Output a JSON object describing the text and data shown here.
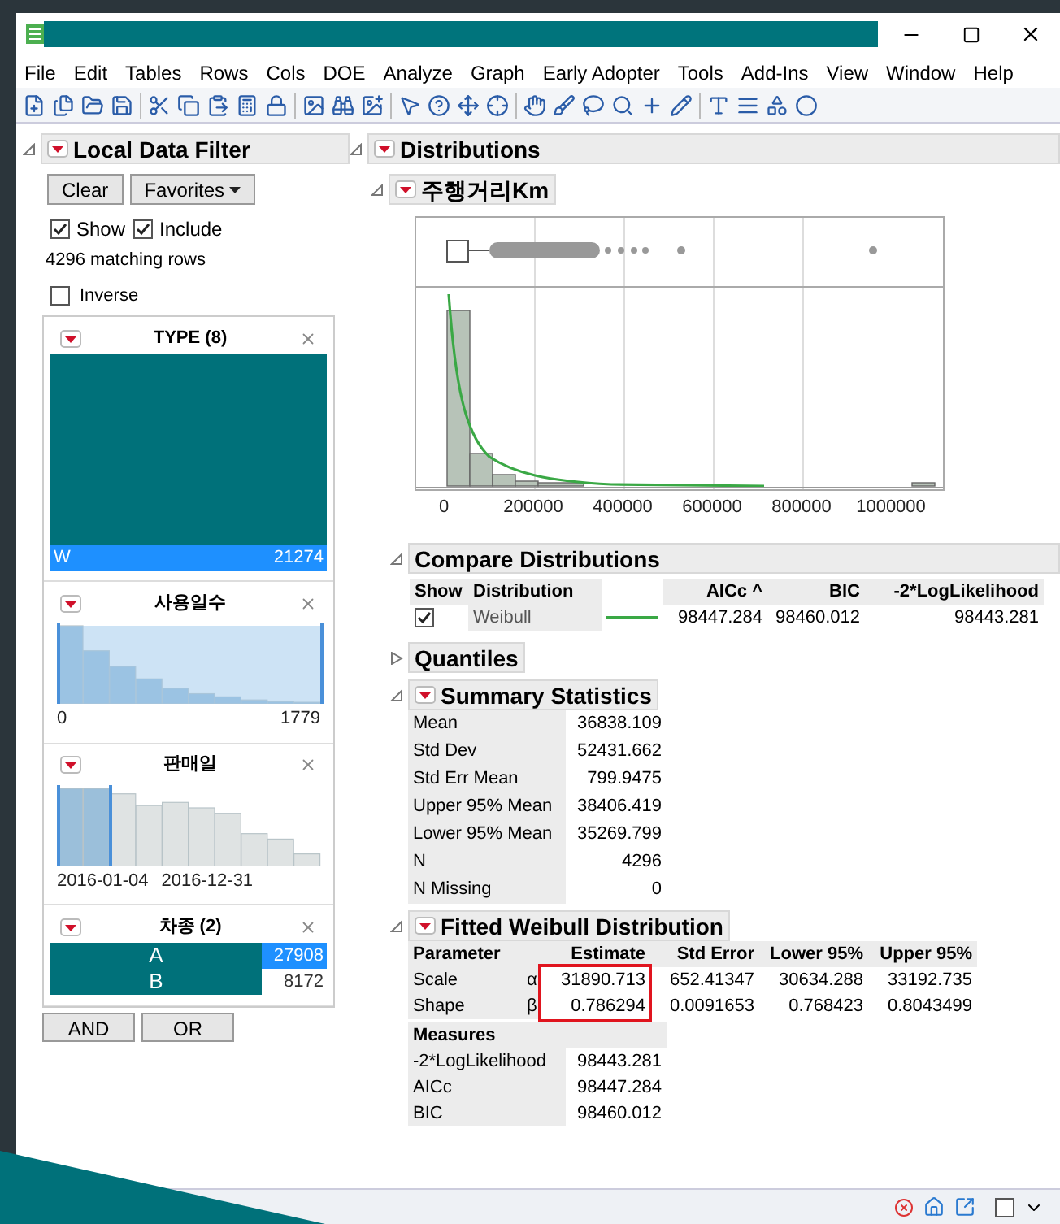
{
  "menu": [
    "File",
    "Edit",
    "Tables",
    "Rows",
    "Cols",
    "DOE",
    "Analyze",
    "Graph",
    "Early Adopter",
    "Tools",
    "Add-Ins",
    "View",
    "Window",
    "Help"
  ],
  "filter": {
    "title": "Local Data Filter",
    "buttons": [
      "Clear",
      "Favorites"
    ],
    "options": [
      {
        "label": "Show",
        "checked": true
      },
      {
        "label": "Include",
        "checked": true
      }
    ],
    "matching": "4296 matching rows",
    "inverse": {
      "label": "Inverse",
      "checked": false
    },
    "items": [
      {
        "kind": "category_bar",
        "title": "TYPE (8)",
        "rows": [
          {
            "label": "W",
            "count": "21274",
            "selected": true
          }
        ]
      },
      {
        "kind": "histogram",
        "title": "사용일수",
        "labels": [
          "0",
          "1779"
        ]
      },
      {
        "kind": "histogram",
        "title": "판매일",
        "labels": [
          "2016-01-04",
          "2016-12-31"
        ]
      },
      {
        "kind": "category_list",
        "title": "차종 (2)",
        "rows": [
          {
            "label": "A",
            "count": "27908",
            "selected": true
          },
          {
            "label": "B",
            "count": "8172",
            "selected": false
          }
        ]
      }
    ],
    "logic_buttons": [
      "AND",
      "OR"
    ]
  },
  "report": {
    "title": "Distributions",
    "variable": "주행거리Km",
    "x_axis_labels": [
      "0",
      "200000",
      "400000",
      "600000",
      "800000",
      "1000000"
    ],
    "compare": {
      "title": "Compare Distributions",
      "columns": [
        "Show",
        "Distribution",
        "AICc ^",
        "BIC",
        "-2*LogLikelihood"
      ],
      "rows": [
        {
          "show": true,
          "name": "Weibull",
          "aicc": "98447.284",
          "bic": "98460.012",
          "loglik": "98443.281"
        }
      ]
    },
    "quantiles": {
      "title": "Quantiles",
      "expanded": false
    },
    "summary": {
      "title": "Summary Statistics",
      "rows": [
        [
          "Mean",
          "36838.109"
        ],
        [
          "Std Dev",
          "52431.662"
        ],
        [
          "Std Err Mean",
          "799.9475"
        ],
        [
          "Upper 95% Mean",
          "38406.419"
        ],
        [
          "Lower 95% Mean",
          "35269.799"
        ],
        [
          "N",
          "4296"
        ],
        [
          "N Missing",
          "0"
        ]
      ]
    },
    "fitted": {
      "title": "Fitted Weibull Distribution",
      "columns": [
        "Parameter",
        "",
        "Estimate",
        "Std Error",
        "Lower 95%",
        "Upper 95%"
      ],
      "estimate_highlighted": true,
      "rows": [
        [
          "Scale",
          "α",
          "31890.713",
          "652.41347",
          "30634.288",
          "33192.735"
        ],
        [
          "Shape",
          "β",
          "0.786294",
          "0.0091653",
          "0.768423",
          "0.8043499"
        ]
      ],
      "measures_title": "Measures",
      "measures": [
        [
          "-2*LogLikelihood",
          "98443.281"
        ],
        [
          "AICc",
          "98447.284"
        ],
        [
          "BIC",
          "98460.012"
        ]
      ]
    }
  },
  "status_bar": {
    "checked": false
  }
}
